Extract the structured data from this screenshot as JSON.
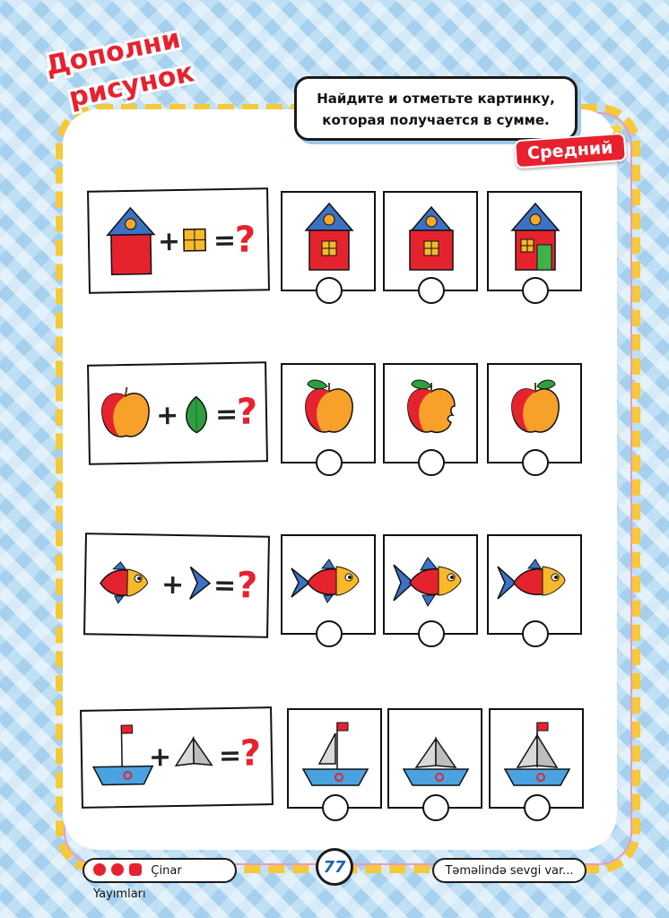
{
  "title": {
    "line1": "Дополни",
    "line2": "рисунок"
  },
  "instruction": {
    "line1": "Найдите и отметьте картинку,",
    "line2": "которая получается в сумме."
  },
  "level_badge": "Средний",
  "operators": {
    "plus": "+",
    "equals": "=",
    "question": "?"
  },
  "rows": [
    {
      "name": "house-row",
      "base": "house",
      "part": "window",
      "options": [
        "house-with-window",
        "house-with-window-small-roof",
        "house-with-window-and-door"
      ]
    },
    {
      "name": "apple-row",
      "base": "apple",
      "part": "leaf",
      "options": [
        "apple-with-leaf",
        "bitten-apple-with-leaf",
        "apple-with-small-leaf"
      ]
    },
    {
      "name": "fish-row",
      "base": "fish",
      "part": "tail-fin",
      "options": [
        "fish-with-tail",
        "fish-with-tail-and-fins",
        "fish-with-tail-no-scales"
      ]
    },
    {
      "name": "boat-row",
      "base": "boat-hull-with-flag",
      "part": "sail",
      "options": [
        "boat-with-one-sail",
        "boat-without-flag",
        "boat-with-sail-and-flag"
      ]
    }
  ],
  "footer": {
    "brand": "Çinar Yayımları",
    "page_number": "77",
    "slogan": "Təməlində sevgi var..."
  },
  "colors": {
    "accent": "#e8212f",
    "frame": "#f6c93a",
    "page_number": "#1e64b4"
  }
}
